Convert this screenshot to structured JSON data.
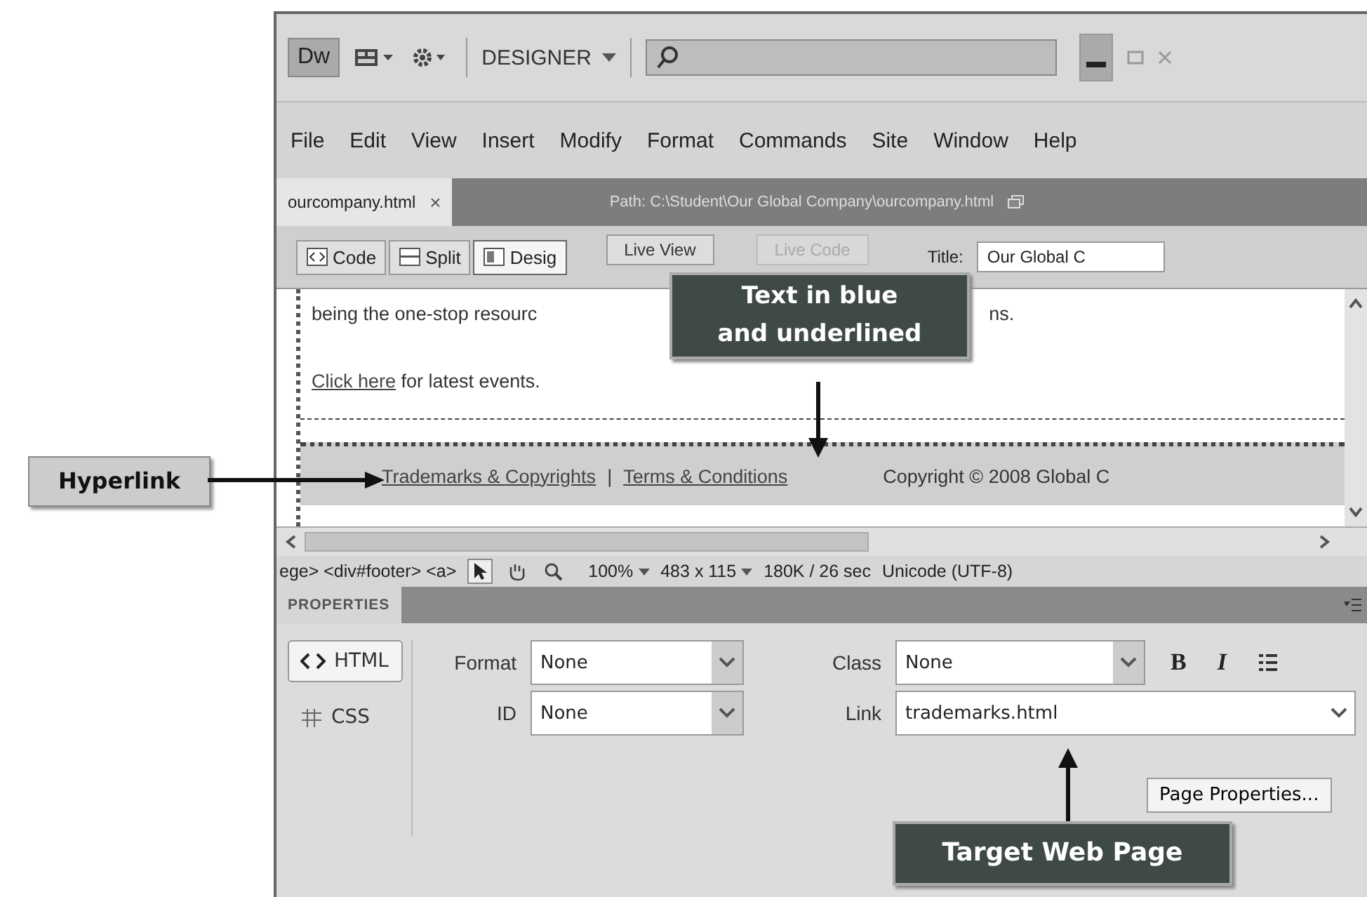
{
  "app_bar": {
    "logo": "Dw",
    "workspace": "DESIGNER"
  },
  "menu": [
    "File",
    "Edit",
    "View",
    "Insert",
    "Modify",
    "Format",
    "Commands",
    "Site",
    "Window",
    "Help"
  ],
  "document_tab": {
    "file": "ourcompany.html",
    "close": "×",
    "path": "Path: C:\\Student\\Our Global Company\\ourcompany.html"
  },
  "view_buttons": [
    {
      "label": "Code",
      "selected": false
    },
    {
      "label": "Split",
      "selected": false
    },
    {
      "label": "Desig",
      "selected": true
    }
  ],
  "live_buttons": [
    {
      "label": "Live View",
      "disabled": false
    },
    {
      "label": "Live Code",
      "disabled": true
    }
  ],
  "title_field": {
    "label": "Title:",
    "value": "Our Global C"
  },
  "page": {
    "text_before": "being the one-stop resourc",
    "text_after": "ns.",
    "link": "Click here",
    "link_rest": " for latest events.",
    "footer_links": [
      "Trademarks & Copyrights",
      "Terms & Conditions"
    ],
    "footer_separator": "|",
    "copyright": "Copyright © 2008 Global C"
  },
  "status_bar": {
    "tag_path": "ege> <div#footer> <a>",
    "zoom": "100%",
    "size": "483 x 115",
    "download": "180K / 26 sec",
    "encoding": "Unicode (UTF-8)"
  },
  "properties": {
    "title": "PROPERTIES",
    "modes": [
      {
        "label": "HTML",
        "selected": true
      },
      {
        "label": "CSS",
        "selected": false
      }
    ],
    "fields": [
      {
        "label": "Format",
        "value": "None",
        "kind": "select"
      },
      {
        "label": "ID",
        "value": "None",
        "kind": "select"
      },
      {
        "label": "Class",
        "value": "None",
        "kind": "select"
      },
      {
        "label": "Link",
        "value": "trademarks.html",
        "kind": "input"
      }
    ],
    "format_buttons": [
      "B",
      "I"
    ],
    "page_properties": "Page Properties..."
  },
  "callouts": [
    {
      "text": "Hyperlink",
      "kind": "light"
    },
    {
      "text": "Text in blue and underlined",
      "kind": "dark"
    },
    {
      "text": "Target Web Page",
      "kind": "dark"
    }
  ]
}
